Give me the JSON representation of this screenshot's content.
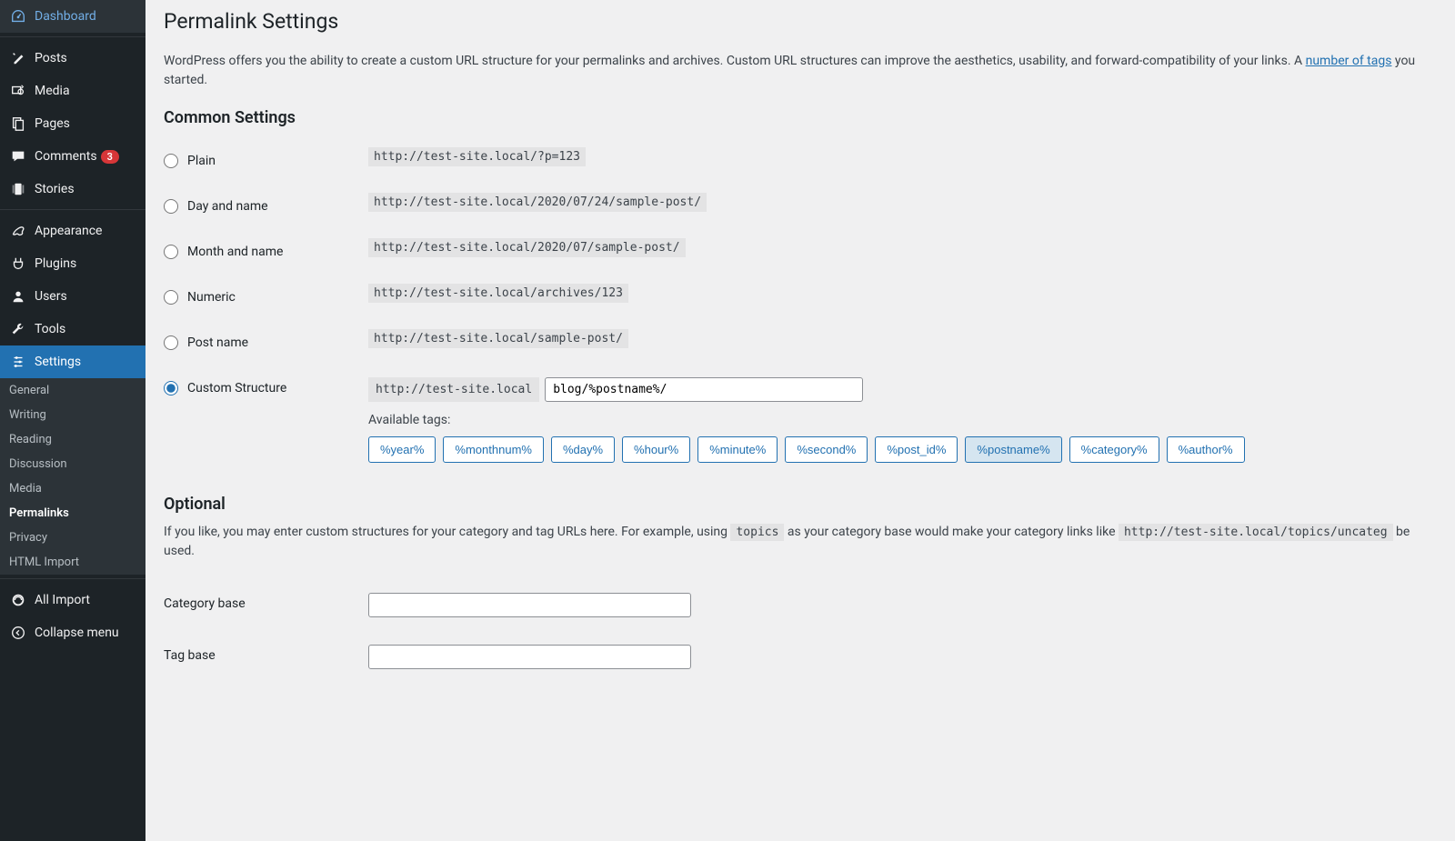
{
  "sidebar": {
    "items": [
      {
        "icon": "dashboard",
        "label": "Dashboard"
      },
      {
        "icon": "posts",
        "label": "Posts",
        "sep_before": true
      },
      {
        "icon": "media",
        "label": "Media"
      },
      {
        "icon": "pages",
        "label": "Pages"
      },
      {
        "icon": "comments",
        "label": "Comments",
        "badge": "3"
      },
      {
        "icon": "stories",
        "label": "Stories"
      },
      {
        "icon": "appearance",
        "label": "Appearance",
        "sep_before": true
      },
      {
        "icon": "plugins",
        "label": "Plugins"
      },
      {
        "icon": "users",
        "label": "Users"
      },
      {
        "icon": "tools",
        "label": "Tools"
      },
      {
        "icon": "settings",
        "label": "Settings",
        "active": true
      }
    ],
    "submenu": [
      "General",
      "Writing",
      "Reading",
      "Discussion",
      "Media",
      "Permalinks",
      "Privacy",
      "HTML Import"
    ],
    "submenu_active": "Permalinks",
    "import_label": "All Import",
    "collapse_label": "Collapse menu"
  },
  "page": {
    "title": "Permalink Settings",
    "intro_a": "WordPress offers you the ability to create a custom URL structure for your permalinks and archives. Custom URL structures can improve the aesthetics, usability, and forward-compatibility of your links. A ",
    "intro_link": "number of tags",
    "intro_b": " you started.",
    "common_heading": "Common Settings",
    "options": [
      {
        "label": "Plain",
        "example": "http://test-site.local/?p=123"
      },
      {
        "label": "Day and name",
        "example": "http://test-site.local/2020/07/24/sample-post/"
      },
      {
        "label": "Month and name",
        "example": "http://test-site.local/2020/07/sample-post/"
      },
      {
        "label": "Numeric",
        "example": "http://test-site.local/archives/123"
      },
      {
        "label": "Post name",
        "example": "http://test-site.local/sample-post/"
      }
    ],
    "custom_label": "Custom Structure",
    "custom_prefix": "http://test-site.local",
    "custom_value": "blog/%postname%/",
    "available_label": "Available tags:",
    "tags": [
      "%year%",
      "%monthnum%",
      "%day%",
      "%hour%",
      "%minute%",
      "%second%",
      "%post_id%",
      "%postname%",
      "%category%",
      "%author%"
    ],
    "tag_active": "%postname%",
    "optional_heading": "Optional",
    "optional_a": "If you like, you may enter custom structures for your category and tag URLs here. For example, using ",
    "optional_code1": "topics",
    "optional_b": " as your category base would make your category links like ",
    "optional_code2": "http://test-site.local/topics/uncateg",
    "optional_c": " be used.",
    "category_label": "Category base",
    "category_value": "",
    "tag_label": "Tag base",
    "tag_value": ""
  }
}
